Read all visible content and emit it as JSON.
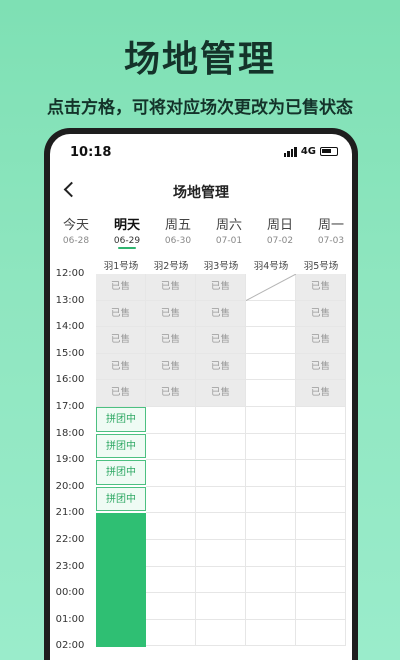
{
  "promo": {
    "title": "场地管理",
    "subtitle": "点击方格，可将对应场次更改为已售状态"
  },
  "status_bar": {
    "time": "10:18",
    "network": "4G"
  },
  "nav": {
    "title": "场地管理"
  },
  "dates": [
    {
      "day": "今天",
      "date": "06-28",
      "active": false
    },
    {
      "day": "明天",
      "date": "06-29",
      "active": true
    },
    {
      "day": "周五",
      "date": "06-30",
      "active": false
    },
    {
      "day": "周六",
      "date": "07-01",
      "active": false
    },
    {
      "day": "周日",
      "date": "07-02",
      "active": false
    },
    {
      "day": "周一",
      "date": "07-03",
      "active": false
    }
  ],
  "courts": [
    "羽1号场",
    "羽2号场",
    "羽3号场",
    "羽4号场",
    "羽5号场"
  ],
  "times": [
    "12:00",
    "13:00",
    "14:00",
    "15:00",
    "16:00",
    "17:00",
    "18:00",
    "19:00",
    "20:00",
    "21:00",
    "22:00",
    "23:00",
    "00:00",
    "01:00",
    "02:00"
  ],
  "status_labels": {
    "sold": "已售",
    "group": "拼团中"
  },
  "slots": [
    [
      "sold",
      "sold",
      "sold",
      "blocked",
      "sold"
    ],
    [
      "sold",
      "sold",
      "sold",
      "free",
      "sold"
    ],
    [
      "sold",
      "sold",
      "sold",
      "free",
      "sold"
    ],
    [
      "sold",
      "sold",
      "sold",
      "free",
      "sold"
    ],
    [
      "sold",
      "sold",
      "sold",
      "free",
      "sold"
    ],
    [
      "group",
      "free",
      "free",
      "free",
      "free"
    ],
    [
      "group",
      "free",
      "free",
      "free",
      "free"
    ],
    [
      "group",
      "free",
      "free",
      "free",
      "free"
    ],
    [
      "group",
      "free",
      "free",
      "free",
      "free"
    ],
    [
      "booked",
      "free",
      "free",
      "free",
      "free"
    ],
    [
      "booked",
      "free",
      "free",
      "free",
      "free"
    ],
    [
      "booked",
      "free",
      "free",
      "free",
      "free"
    ],
    [
      "booked",
      "free",
      "free",
      "free",
      "free"
    ],
    [
      "booked",
      "free",
      "free",
      "free",
      "free"
    ]
  ],
  "colors": {
    "accent": "#2fbf73",
    "sold_bg": "#ebebeb",
    "group_bg": "#effbf4"
  }
}
